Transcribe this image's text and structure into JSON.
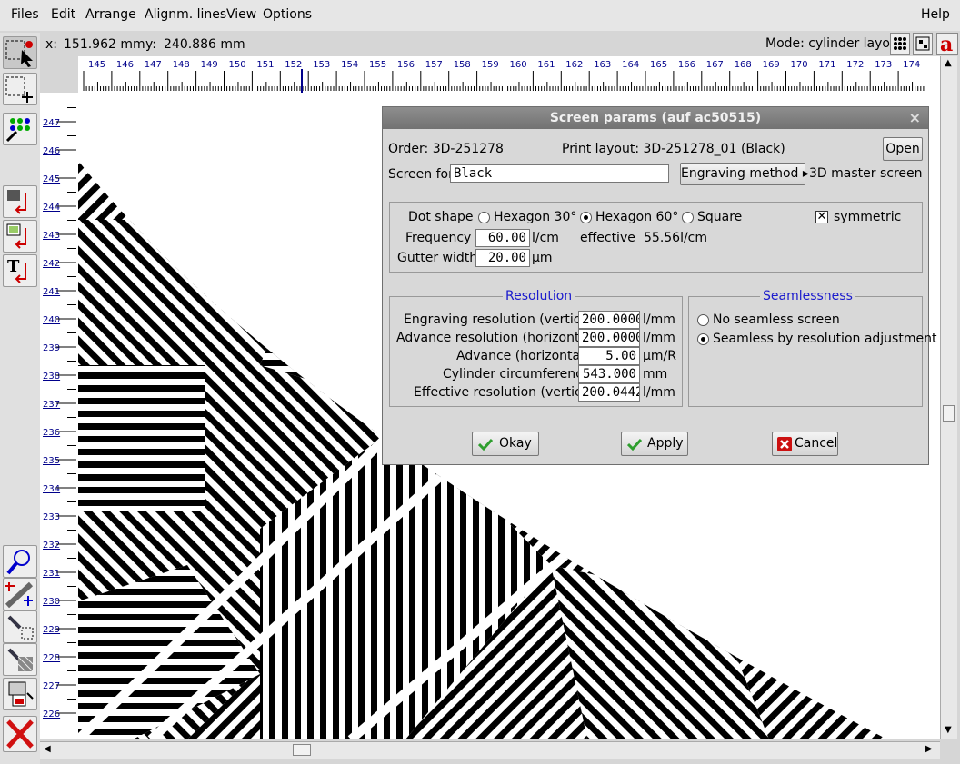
{
  "menu": {
    "files": "Files",
    "edit": "Edit",
    "arrange": "Arrange",
    "alignm_lines": "Alignm. lines",
    "view": "View",
    "options": "Options",
    "help": "Help"
  },
  "coords": {
    "x_label": "x:",
    "x_value": "151.962 mm",
    "y_label": "y:",
    "y_value": "240.886 mm"
  },
  "mode": {
    "label": "Mode: cylinder layout"
  },
  "hruler_ticks": [
    "145",
    "146",
    "147",
    "148",
    "149",
    "150",
    "151",
    "152",
    "153",
    "154",
    "155",
    "156",
    "157",
    "158",
    "159",
    "160",
    "161",
    "162",
    "163",
    "164",
    "165",
    "166",
    "167",
    "168",
    "169",
    "170",
    "171",
    "172",
    "173",
    "174"
  ],
  "vruler_ticks": [
    "247",
    "246",
    "245",
    "244",
    "243",
    "242",
    "241",
    "240",
    "239",
    "238",
    "237",
    "236",
    "235",
    "234",
    "233",
    "232",
    "231",
    "230",
    "229",
    "228",
    "227",
    "226"
  ],
  "dialog": {
    "title": "Screen params (auf ac50515)",
    "close": "×",
    "order": "Order: 3D-251278",
    "print_layout": "Print layout: 3D-251278_01 (Black)",
    "open_btn": "Open",
    "screen_for_label": "Screen for",
    "screen_for_value": "Black",
    "engraving_method_btn": "Engraving method ▸",
    "engraving_method_value": "3D master screen",
    "dot_shape_label": "Dot shape",
    "dot_shapes": [
      "Hexagon 30°",
      "Hexagon 60°",
      "Square"
    ],
    "dot_shape_selected": "Hexagon 60°",
    "symmetric_label": "symmetric",
    "symmetric_checked": true,
    "frequency_label": "Frequency",
    "frequency_value": "60.00",
    "frequency_unit": "l/cm",
    "effective_label": "effective",
    "effective_value": "55.56l/cm",
    "gutter_label": "Gutter width",
    "gutter_value": "20.00",
    "gutter_unit": "µm",
    "resolution_title": "Resolution",
    "resolution_rows": [
      {
        "label": "Engraving resolution (vertical)",
        "value": "200.0000",
        "unit": "l/mm"
      },
      {
        "label": "Advance resolution (horizontal)",
        "value": "200.0000",
        "unit": "l/mm"
      },
      {
        "label": "Advance (horizontal)",
        "value": "5.00",
        "unit": "µm/R"
      },
      {
        "label": "Cylinder circumference",
        "value": "543.000",
        "unit": "mm"
      },
      {
        "label": "Effective resolution (vertical)",
        "value": "200.0442",
        "unit": "l/mm"
      }
    ],
    "seamless_title": "Seamlessness",
    "seamless_options": [
      "No seamless screen",
      "Seamless by resolution adjustment"
    ],
    "seamless_selected": "Seamless by resolution adjustment",
    "okay_btn": "Okay",
    "apply_btn": "Apply",
    "cancel_btn": "Cancel"
  },
  "colors": {
    "title_bar": "#7d7d7d",
    "group_title": "#1a1acd",
    "ruler_label": "#00008b",
    "ok_check": "#2e9e2e",
    "cancel_x": "#cc1111"
  }
}
